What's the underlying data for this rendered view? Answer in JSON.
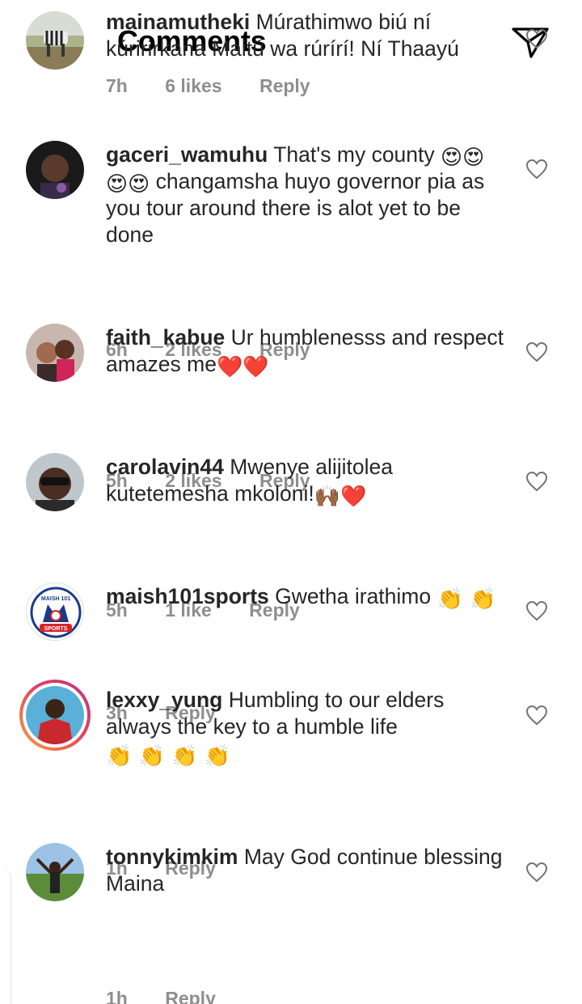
{
  "header": {
    "title": "Comments",
    "back_icon": "arrow-left-icon",
    "share_icon": "paper-plane-icon"
  },
  "comments": [
    {
      "username": "mainamutheki",
      "text": "Múrathimwo biú ní kúririrkana Maitú wa rúrírí! Ní Thaayú",
      "time": "7h",
      "likes": "6 likes",
      "reply": "Reply"
    },
    {
      "username": "gaceri_wamuhu",
      "text_a": "That's my county",
      "emoji_a": "😍😍",
      "emoji_b": "😍😍",
      "text_b": "changamsha huyo governor pia as you tour around there is alot yet to be done",
      "time": "6h",
      "likes": "2 likes",
      "reply": "Reply"
    },
    {
      "username": "faith_kabue",
      "text": "Ur humblenesss and respect amazes me",
      "emoji": "❤️❤️",
      "time": "5h",
      "likes": "2 likes",
      "reply": "Reply"
    },
    {
      "username": "carolavin44",
      "text": "Mwenye alijitolea kutetemesha mkoloni!",
      "emoji": "🙌🏾❤️",
      "time": "5h",
      "likes": "1 like",
      "reply": "Reply"
    },
    {
      "username": "maish101sports",
      "text": "Gwetha irathimo",
      "emoji": "👏 👏",
      "time": "3h",
      "reply": "Reply",
      "avatar_text_top": "MAISH 101",
      "avatar_text_bottom": "SPORTS"
    },
    {
      "username": "lexxy_yung",
      "text": "Humbling to our elders always the key to a humble life",
      "emoji": "👏 👏 👏 👏",
      "time": "1h",
      "reply": "Reply"
    },
    {
      "username": "tonnykimkim",
      "text": "May God continue blessing Maina",
      "time": "1h",
      "reply": "Reply"
    }
  ],
  "colors": {
    "text": "#262626",
    "meta": "#8e8e8e",
    "heart_emoji": "#e0245e",
    "clap_emoji": "#f5c400"
  }
}
